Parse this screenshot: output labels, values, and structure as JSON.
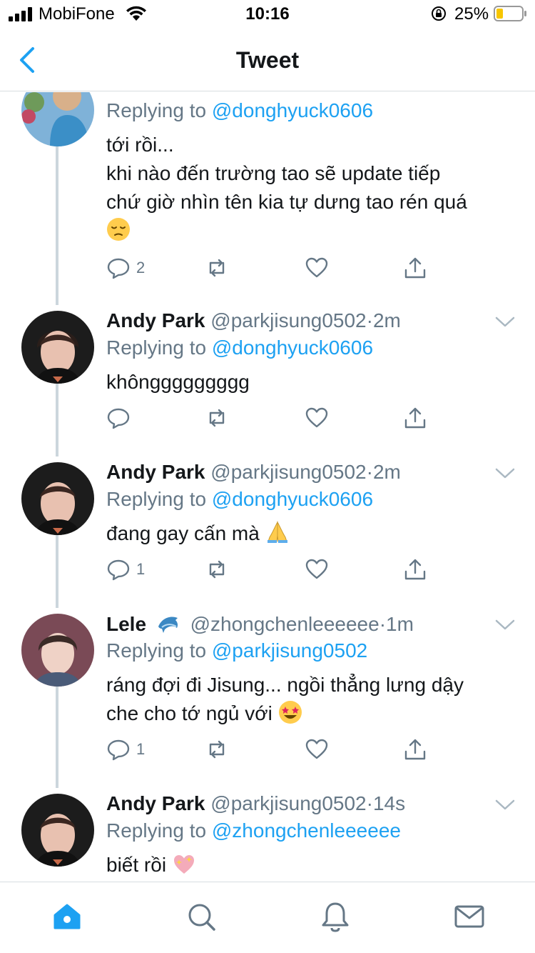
{
  "status_bar": {
    "carrier": "MobiFone",
    "time": "10:16",
    "battery": "25%"
  },
  "header": {
    "title": "Tweet",
    "back_icon": "chevron-left-icon"
  },
  "colors": {
    "accent": "#1da1f2",
    "text": "#14171a",
    "secondary": "#657786",
    "divider": "#ccd6dd"
  },
  "tweets": [
    {
      "name": "",
      "handle": "",
      "dot": "",
      "time": "",
      "replying_prefix": "Replying to ",
      "replying_to": "@donghyuck0606",
      "lines": [
        "tới rồi...",
        "khi nào đến trường tao sẽ update tiếp",
        "chứ giờ nhìn tên kia tự dưng tao rén quá"
      ],
      "trailing_emoji": "pensive-face-emoji",
      "reply_count": "2"
    },
    {
      "name": "Andy Park",
      "handle": "@parkjisung0502",
      "dot": "·",
      "time": "2m",
      "replying_prefix": "Replying to ",
      "replying_to": "@donghyuck0606",
      "lines": [
        "khônggggggggg"
      ],
      "reply_count": ""
    },
    {
      "name": "Andy Park",
      "handle": "@parkjisung0502",
      "dot": "·",
      "time": "2m",
      "replying_prefix": "Replying to ",
      "replying_to": "@donghyuck0606",
      "lines": [
        "đang gay cấn mà "
      ],
      "trailing_emoji": "folded-hands-emoji",
      "reply_count": "1"
    },
    {
      "name": "Lele",
      "name_emoji": "dolphin-emoji",
      "handle": "@zhongchenleeeeee",
      "dot": "·",
      "time": "1m",
      "replying_prefix": "Replying to ",
      "replying_to": "@parkjisung0502",
      "lines": [
        "ráng đợi đi Jisung... ngồi thẳng lưng dậy",
        "che cho tớ ngủ với "
      ],
      "trailing_emoji": "star-struck-emoji",
      "reply_count": "1"
    },
    {
      "name": "Andy Park",
      "handle": "@parkjisung0502",
      "dot": "·",
      "time": "14s",
      "replying_prefix": "Replying to ",
      "replying_to": "@zhongchenleeeeee",
      "lines": [
        "biết rồi "
      ],
      "trailing_emoji": "sparkling-heart-emoji",
      "reply_count": ""
    }
  ],
  "tab_bar": {
    "tabs": [
      "home-icon",
      "search-icon",
      "notifications-icon",
      "messages-icon"
    ],
    "active": "home-icon"
  }
}
